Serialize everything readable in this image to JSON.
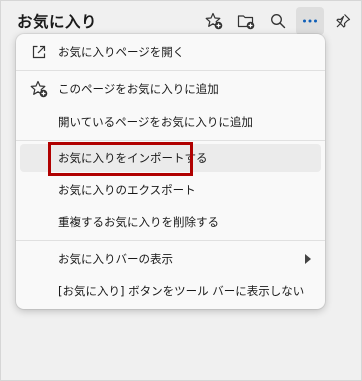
{
  "header": {
    "title": "お気に入り",
    "buttons": [
      {
        "icon": "add-favorite-star-icon"
      },
      {
        "icon": "add-folder-icon"
      },
      {
        "icon": "search-icon"
      },
      {
        "icon": "more-options-icon"
      },
      {
        "icon": "pin-icon"
      }
    ]
  },
  "menu": {
    "items": [
      {
        "label": "お気に入りページを開く",
        "icon": "open-page-icon"
      },
      {
        "label": "このページをお気に入りに追加",
        "icon": "add-favorite-star-icon"
      },
      {
        "label": "開いているページをお気に入りに追加"
      },
      {
        "label": "お気に入りをインポートする"
      },
      {
        "label": "お気に入りのエクスポート"
      },
      {
        "label": "重複するお気に入りを削除する"
      },
      {
        "label": "お気に入りバーの表示",
        "submenu": true
      },
      {
        "label": "[お気に入り] ボタンをツール バーに表示しない"
      }
    ]
  },
  "colors": {
    "highlight_border": "#b00000",
    "menu_background": "#f9f9f9",
    "hover_background": "#ebebeb"
  }
}
